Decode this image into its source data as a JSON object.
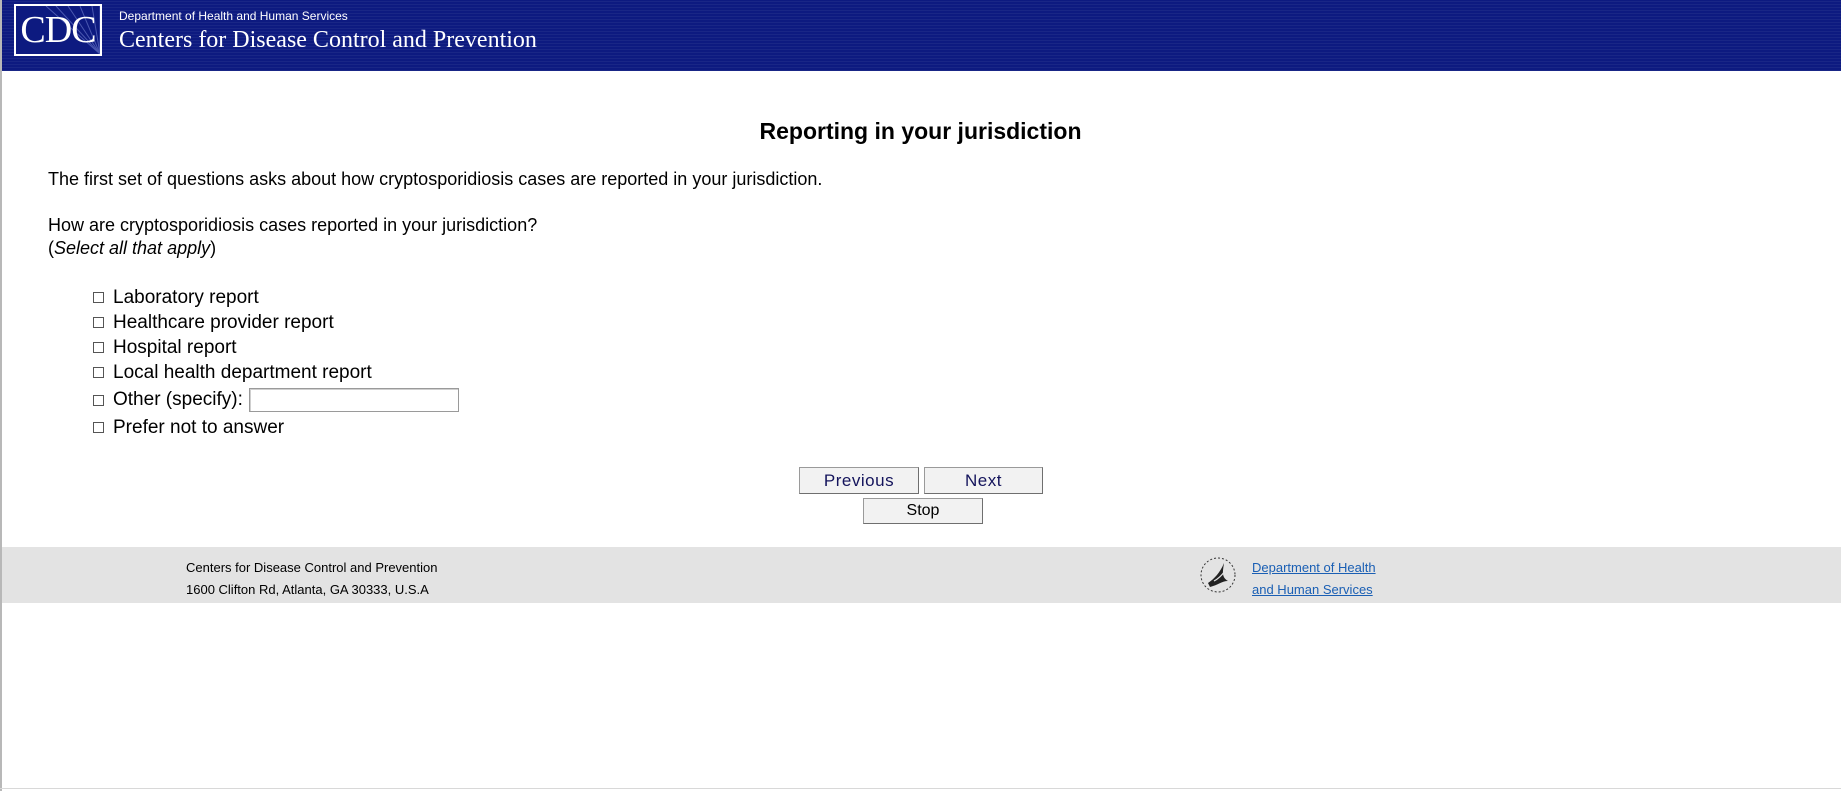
{
  "header": {
    "logo_text": "CDC",
    "department": "Department of Health and Human Services",
    "agency": "Centers for Disease Control and Prevention",
    "background_color": "#0d1a80"
  },
  "main": {
    "title": "Reporting in your jurisdiction",
    "intro": "The first set of questions asks about how cryptosporidiosis cases are reported in your jurisdiction.",
    "question": "How are cryptosporidiosis cases reported in your jurisdiction?",
    "instruction": "Select all that apply",
    "options": [
      {
        "label": "Laboratory report",
        "checked": false
      },
      {
        "label": "Healthcare provider report",
        "checked": false
      },
      {
        "label": "Hospital report",
        "checked": false
      },
      {
        "label": "Local health department report",
        "checked": false
      },
      {
        "label": "Other (specify):",
        "checked": false
      },
      {
        "label": "Prefer not to answer",
        "checked": false
      }
    ],
    "other_specify_value": ""
  },
  "buttons": {
    "previous": "Previous",
    "next": "Next",
    "stop": "Stop"
  },
  "footer": {
    "org": "Centers for Disease Control and Prevention",
    "address": "1600 Clifton Rd, Atlanta, GA 30333, U.S.A",
    "hhs_link_line1": "Department of Health",
    "hhs_link_line2": "and Human Services",
    "hhs_icon": "hhs-eagle-icon",
    "background_color": "#e3e3e3",
    "link_color": "#1a5fb4"
  }
}
